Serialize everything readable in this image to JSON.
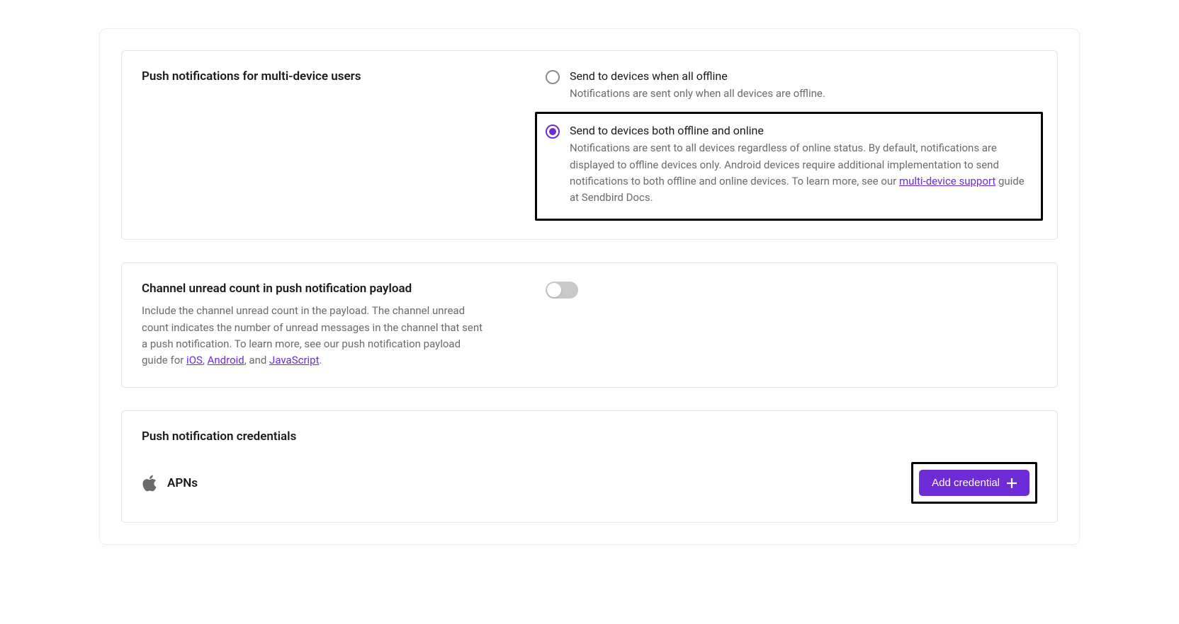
{
  "section1": {
    "title": "Push notifications for multi-device users",
    "option1": {
      "label": "Send to devices when all offline",
      "desc": "Notifications are sent only when all devices are offline."
    },
    "option2": {
      "label": "Send to devices both offline and online",
      "desc_pre": "Notifications are sent to all devices regardless of online status. By default, notifications are displayed to offline devices only. Android devices require additional implementation to send notifications to both offline and online devices. To learn more, see our ",
      "link": "multi-device support",
      "desc_post": " guide at Sendbird Docs."
    }
  },
  "section2": {
    "title": "Channel unread count in push notification payload",
    "desc_pre": "Include the channel unread count in the payload. The channel unread count indicates the number of unread messages in the channel that sent a push notification. To learn more, see our push notification payload guide for ",
    "link_ios": "iOS",
    "sep1": ", ",
    "link_android": "Android",
    "sep2": ", and ",
    "link_js": "JavaScript",
    "desc_post": "."
  },
  "section3": {
    "title": "Push notification credentials",
    "apns_label": "APNs",
    "button_label": "Add credential"
  }
}
